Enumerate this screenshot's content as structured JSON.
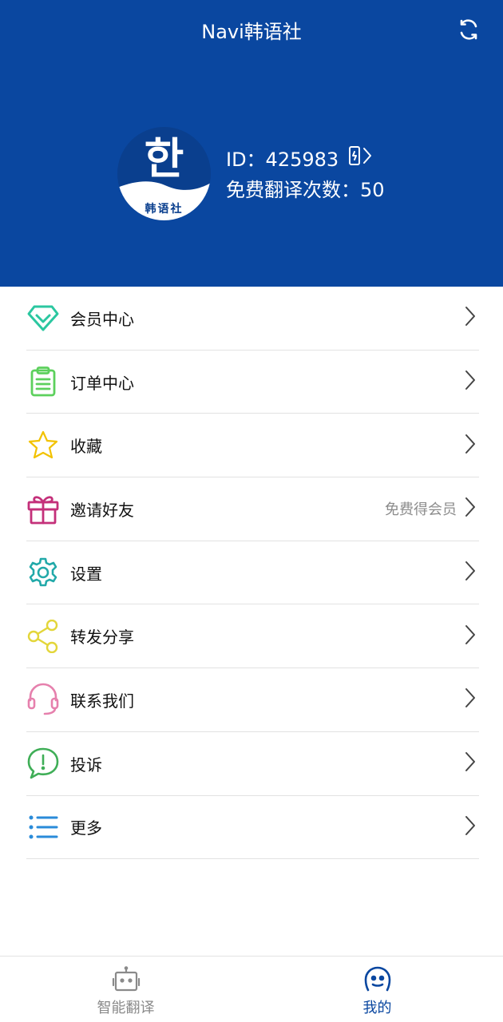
{
  "header": {
    "title": "Navi韩语社",
    "refresh_icon": "refresh-icon",
    "background": "#0a47a0"
  },
  "profile": {
    "avatar": {
      "glyph": "한",
      "caption": "韩语社"
    },
    "id_text": "ID：425983",
    "id_action_icon": "phone-bind-icon",
    "free_count_text": "免费翻译次数：50"
  },
  "menu": [
    {
      "label": "会员中心",
      "icon": "diamond-icon",
      "color": "#2bc7a0"
    },
    {
      "label": "订单中心",
      "icon": "clipboard-icon",
      "color": "#5cd05c"
    },
    {
      "label": "收藏",
      "icon": "star-icon",
      "color": "#f2c200"
    },
    {
      "label": "邀请好友",
      "icon": "gift-icon",
      "color": "#c4307a",
      "extra": "免费得会员"
    },
    {
      "label": "设置",
      "icon": "gear-icon",
      "color": "#22a9a9"
    },
    {
      "label": "转发分享",
      "icon": "share-icon",
      "color": "#e3d63a"
    },
    {
      "label": "联系我们",
      "icon": "headset-icon",
      "color": "#e680ad"
    },
    {
      "label": "投诉",
      "icon": "alert-chat-icon",
      "color": "#3fae57"
    },
    {
      "label": "更多",
      "icon": "list-icon",
      "color": "#2a8bd9"
    }
  ],
  "tabbar": {
    "tabs": [
      {
        "label": "智能翻译",
        "icon": "robot-icon",
        "active": false,
        "color": "#8a8a8a"
      },
      {
        "label": "我的",
        "icon": "user-smile-icon",
        "active": true,
        "color": "#0a47a0"
      }
    ]
  }
}
